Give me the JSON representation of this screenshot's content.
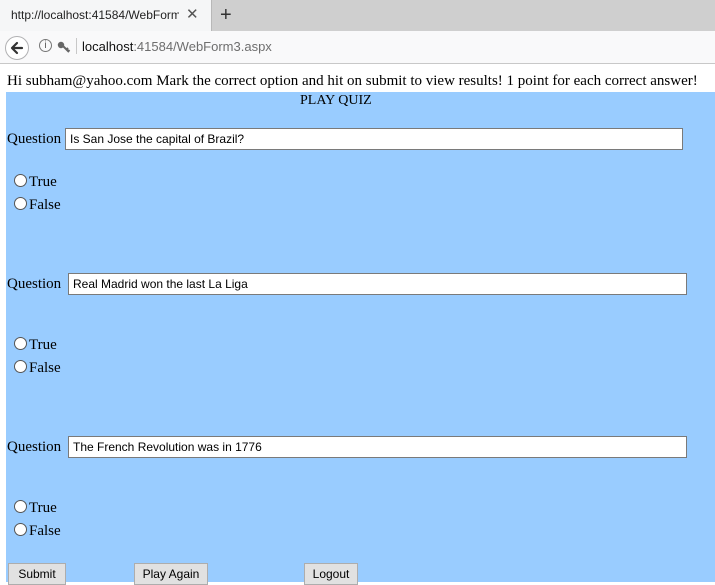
{
  "browser": {
    "tab_title": "http://localhost:41584/WebForm",
    "tab_close": "✕",
    "new_tab": "+",
    "url_host": "localhost",
    "url_rest": ":41584/WebForm3.aspx"
  },
  "page": {
    "greeting": "Hi subham@yahoo.com Mark the correct option and hit on submit to view results! 1 point for each correct answer!",
    "title": "PLAY QUIZ",
    "question_label": "Question",
    "questions": [
      {
        "text": "Is San Jose the capital of Brazil?",
        "option_true": "True",
        "option_false": "False"
      },
      {
        "text": "Real Madrid won the last La Liga",
        "option_true": "True",
        "option_false": "False"
      },
      {
        "text": "The French Revolution was in 1776",
        "option_true": "True",
        "option_false": "False"
      }
    ],
    "buttons": {
      "submit": "Submit",
      "play_again": "Play Again",
      "logout": "Logout"
    }
  },
  "colors": {
    "panel_background": "#99ccff"
  }
}
